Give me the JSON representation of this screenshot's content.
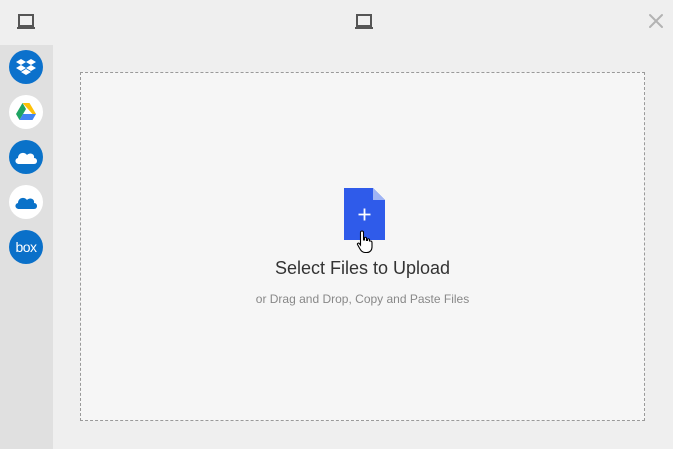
{
  "header": {
    "left_icon": "laptop-icon",
    "center_icon": "laptop-icon",
    "close_icon": "close-icon"
  },
  "sources": [
    {
      "id": "dropbox",
      "icon": "dropbox-icon",
      "color": "#0b71cc"
    },
    {
      "id": "google-drive",
      "icon": "google-drive-icon",
      "color": "#ffffff"
    },
    {
      "id": "onedrive",
      "icon": "onedrive-icon",
      "color": "#0a72c9"
    },
    {
      "id": "onedrive-business",
      "icon": "onedrive-business-icon",
      "color": "#ffffff"
    },
    {
      "id": "box",
      "icon": "box-icon",
      "label": "box",
      "color": "#0a70c9"
    }
  ],
  "dropzone": {
    "title": "Select Files to Upload",
    "subtitle": "or Drag and Drop, Copy and Paste Files",
    "accent_color": "#2f5bea"
  }
}
